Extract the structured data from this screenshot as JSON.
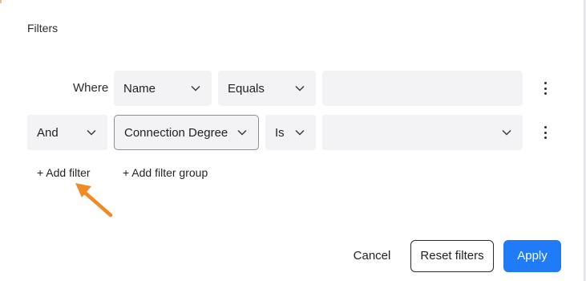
{
  "dialog": {
    "title": "Filters"
  },
  "rows": [
    {
      "prefix_label": "Where",
      "field": "Name",
      "operator": "Equals",
      "value": ""
    },
    {
      "conjunction": "And",
      "field": "Connection Degree",
      "operator": "Is",
      "value": ""
    }
  ],
  "actions": {
    "add_filter": "+ Add filter",
    "add_filter_group": "+ Add filter group"
  },
  "footer": {
    "cancel": "Cancel",
    "reset": "Reset filters",
    "apply": "Apply"
  },
  "colors": {
    "accent": "#1f7cf6",
    "annotation_arrow": "#f08a24",
    "field_bg": "#f3f3f5"
  },
  "icons": {
    "dropdown": "chevron-down-icon",
    "row_menu": "more-vertical-icon",
    "annotation": "arrow-pointer-icon"
  }
}
